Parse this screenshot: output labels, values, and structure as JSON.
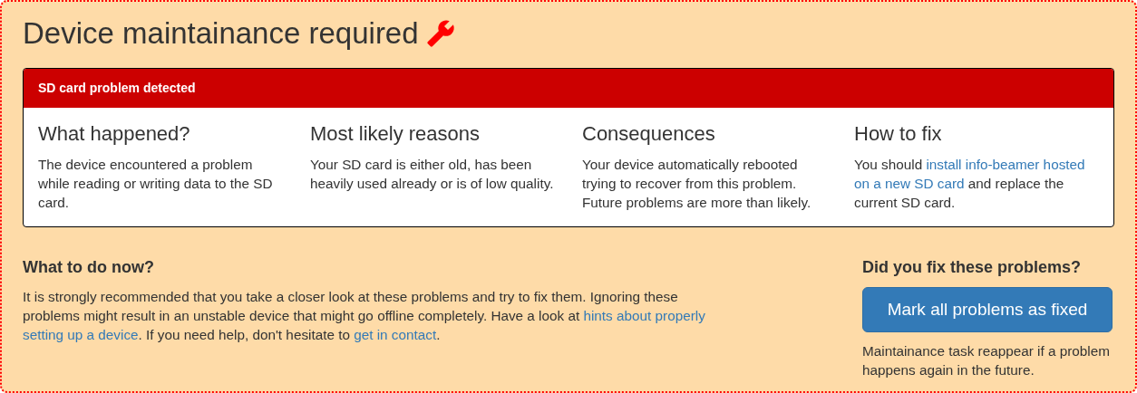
{
  "title": "Device maintainance required",
  "problem": {
    "header": "SD card problem detected",
    "columns": [
      {
        "heading": "What happened?",
        "text": [
          {
            "kind": "text",
            "text": "The device encountered a problem while reading or writing data to the SD card."
          }
        ]
      },
      {
        "heading": "Most likely reasons",
        "text": [
          {
            "kind": "text",
            "text": "Your SD card is either old, has been heavily used already or is of low quality."
          }
        ]
      },
      {
        "heading": "Consequences",
        "text": [
          {
            "kind": "text",
            "text": "Your device automatically rebooted trying to recover from this problem. Future problems are more than likely."
          }
        ]
      },
      {
        "heading": "How to fix",
        "text": [
          {
            "kind": "text",
            "text": "You should "
          },
          {
            "kind": "link",
            "text": "install info-beamer hosted"
          },
          {
            "kind": "break"
          },
          {
            "kind": "link",
            "text": "on a new SD card"
          },
          {
            "kind": "text",
            "text": " and replace the current SD card."
          }
        ]
      }
    ]
  },
  "todo": {
    "heading": "What to do now?",
    "text": [
      {
        "kind": "text",
        "text": "It is strongly recommended that you take a closer look at these problems and try to fix them. Ignoring these problems might result in an unstable device that might go offline completely. Have a look at "
      },
      {
        "kind": "link",
        "text": "hints about properly"
      },
      {
        "kind": "break"
      },
      {
        "kind": "link",
        "text": "setting up a device"
      },
      {
        "kind": "text",
        "text": ". If you need help, don't hesitate to "
      },
      {
        "kind": "link",
        "text": "get in contact"
      },
      {
        "kind": "text",
        "text": "."
      }
    ]
  },
  "fix": {
    "heading": "Did you fix these problems?",
    "button": "Mark all problems as fixed",
    "note": "Maintainance task reappear if a problem happens again in the future."
  }
}
